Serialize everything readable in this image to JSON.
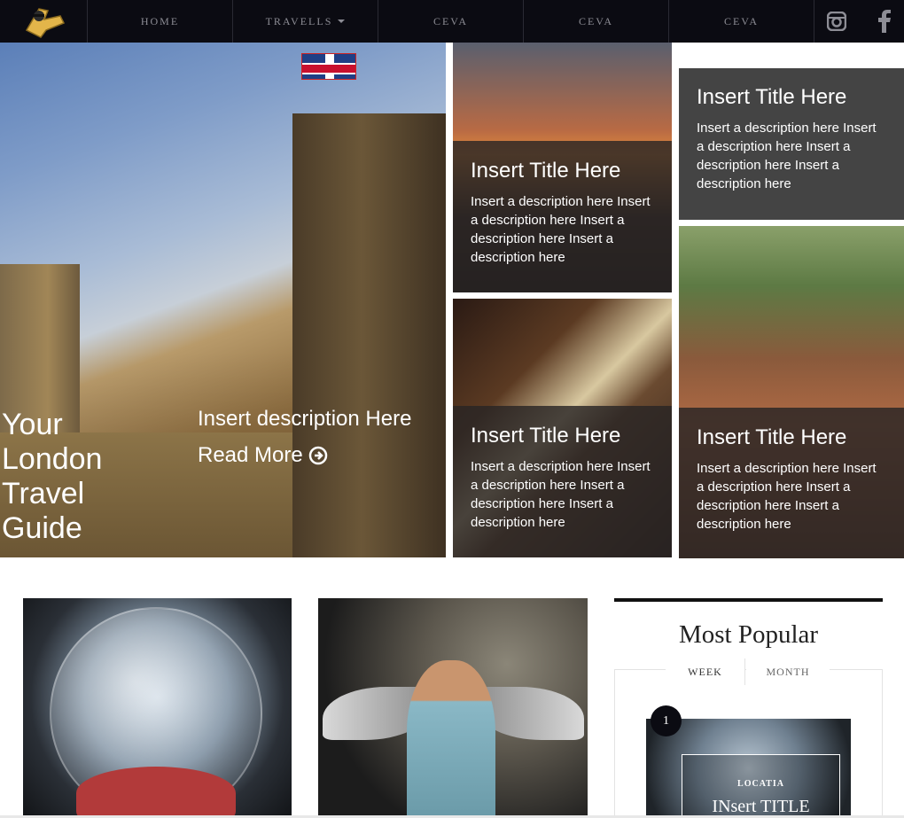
{
  "nav": {
    "items": [
      {
        "label": "HOME"
      },
      {
        "label": "TRAVELLS",
        "has_dropdown": true
      },
      {
        "label": "CEVA"
      },
      {
        "label": "CEVA"
      },
      {
        "label": "CEVA"
      }
    ],
    "social": [
      "instagram-icon",
      "facebook-icon"
    ]
  },
  "hero": {
    "title": "Your London Travel Guide",
    "description": "Insert description Here",
    "read_more": "Read More"
  },
  "tiles": [
    {
      "title": "Insert Title Here",
      "description": "Insert a description here Insert a description here Insert a description here Insert a description here"
    },
    {
      "title": "Insert Title Here",
      "description": "Insert a description here Insert a description here Insert a description here Insert a description here"
    },
    {
      "title": "Insert Title Here",
      "description": "Insert a description here Insert a description here Insert a description here Insert a description here"
    },
    {
      "title": "Insert Title Here",
      "description": "Insert a description here Insert a description here Insert a description here Insert a description here"
    }
  ],
  "popular": {
    "title": "Most Popular",
    "tabs": [
      "WEEK",
      "MONTH"
    ],
    "items": [
      {
        "rank": "1",
        "location": "LOCATIA",
        "title": "INsert TITLE"
      }
    ]
  },
  "colors": {
    "nav_bg": "#0b0b12",
    "tile_overlay": "#444444"
  }
}
